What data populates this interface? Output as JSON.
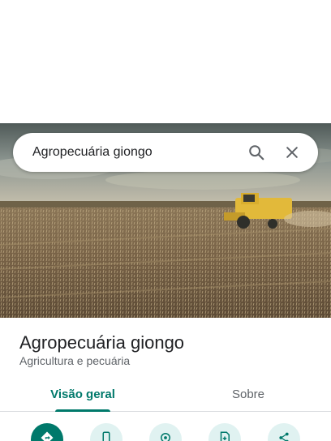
{
  "search": {
    "query": "Agropecuária giongo"
  },
  "place": {
    "name": "Agropecuária giongo",
    "category": "Agricultura e pecuária"
  },
  "tabs": [
    {
      "label": "Visão geral",
      "active": true
    },
    {
      "label": "Sobre",
      "active": false
    }
  ],
  "actions": [
    {
      "icon": "directions-icon"
    },
    {
      "icon": "phone-icon"
    },
    {
      "icon": "location-icon"
    },
    {
      "icon": "save-icon"
    },
    {
      "icon": "share-icon"
    }
  ],
  "colors": {
    "accent": "#00796b",
    "accent_light": "#e0f2f1"
  }
}
